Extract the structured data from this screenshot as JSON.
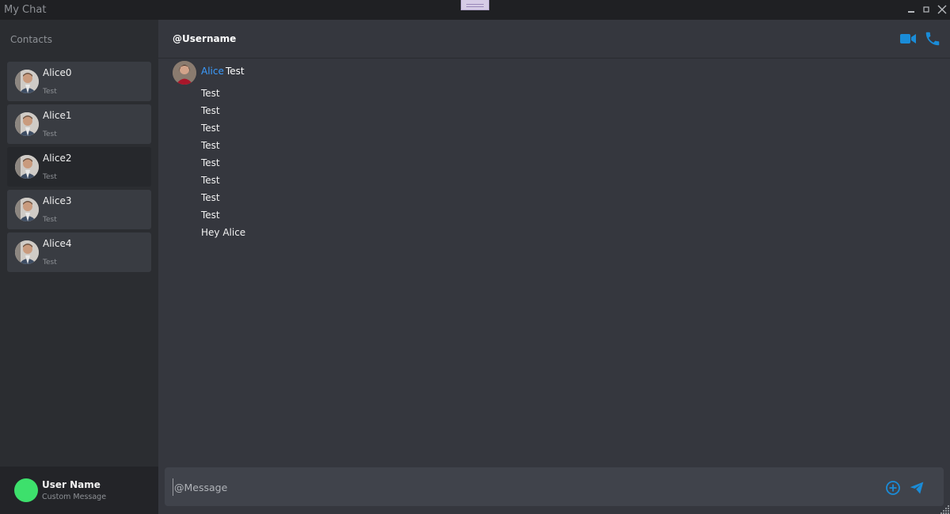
{
  "window": {
    "title": "My Chat",
    "controls": {
      "minimize": "🗕",
      "maximize": "🗖",
      "close": "✕"
    }
  },
  "sidebar": {
    "header": "Contacts",
    "contacts": [
      {
        "name": "Alice0",
        "preview": "Test",
        "active": false
      },
      {
        "name": "Alice1",
        "preview": "Test",
        "active": false
      },
      {
        "name": "Alice2",
        "preview": "Test",
        "active": true
      },
      {
        "name": "Alice3",
        "preview": "Test",
        "active": false
      },
      {
        "name": "Alice4",
        "preview": "Test",
        "active": false
      }
    ],
    "user": {
      "name": "User Name",
      "status": "Custom Message",
      "status_color": "#3de06c"
    }
  },
  "chat": {
    "handle": "@Username",
    "icons": [
      "video-icon",
      "phone-icon"
    ],
    "accent": "#1a8cd8",
    "messages": {
      "author": "Alice",
      "author_color": "#3b9cff",
      "first": "Test",
      "lines": [
        "Test",
        "Test",
        "Test",
        "Test",
        "Test",
        "Test",
        "Test",
        "Test",
        "Hey Alice"
      ]
    },
    "composer": {
      "placeholder": "@Message",
      "value": "",
      "icons": [
        "add-circle-icon",
        "send-icon"
      ]
    }
  }
}
